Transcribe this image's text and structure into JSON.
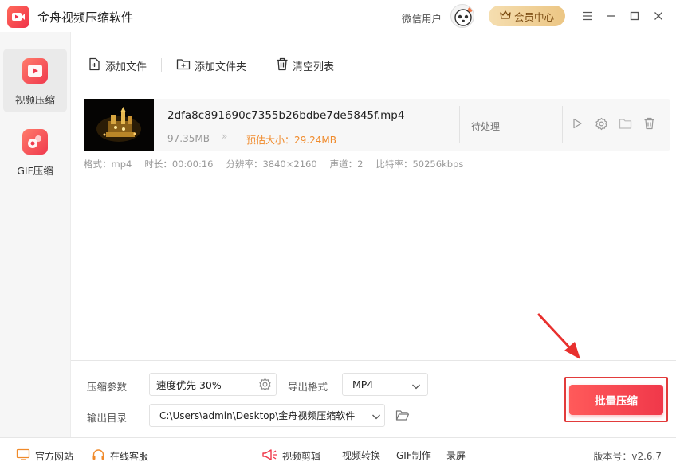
{
  "app": {
    "title": "金舟视频压缩软件",
    "user_name": "微信用户",
    "member_label": "会员中心"
  },
  "sidebar": {
    "items": [
      {
        "label": "视频压缩",
        "active": true
      },
      {
        "label": "GIF压缩",
        "active": false
      }
    ]
  },
  "toolbar": {
    "add_file": "添加文件",
    "add_folder": "添加文件夹",
    "clear_list": "清空列表"
  },
  "file": {
    "name": "2dfa8c891690c7355b26bdbe7de5845f.mp4",
    "size": "97.35MB",
    "arrows": "»",
    "estimated": "预估大小：29.24MB",
    "status": "待处理",
    "meta": {
      "format": "格式：mp4",
      "duration": "时长：00:00:16",
      "resolution": "分辨率：3840×2160",
      "channels": "声道：2",
      "bitrate": "比特率：50256kbps"
    }
  },
  "settings": {
    "param_label": "压缩参数",
    "param_value": "速度优先 30%",
    "format_label": "导出格式",
    "format_value": "MP4",
    "output_label": "输出目录",
    "output_value": "C:\\Users\\admin\\Desktop\\金舟视频压缩软件",
    "batch_button": "批量压缩"
  },
  "footer": {
    "website": "官方网站",
    "support": "在线客服",
    "video_edit": "视频剪辑",
    "video_convert": "视频转换",
    "gif_make": "GIF制作",
    "record": "录屏",
    "version": "版本号：v2.6.7"
  },
  "colors": {
    "accent": "#f0384a",
    "estimate": "#f08a2a",
    "member_gold": "#ecc684"
  }
}
